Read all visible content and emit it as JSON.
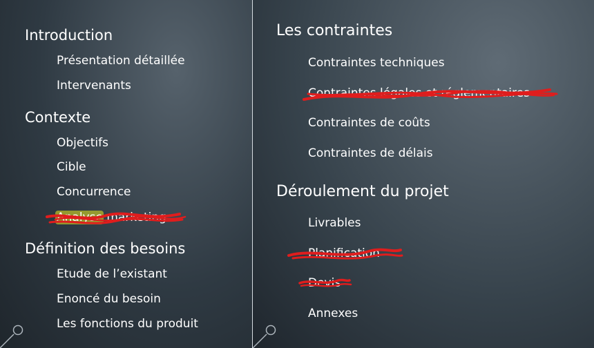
{
  "left_column": {
    "section1": {
      "title": "Introduction",
      "items": [
        "Présentation détaillée",
        "Intervenants"
      ]
    },
    "section2": {
      "title": "Contexte",
      "items": [
        "Objectifs",
        "Cible",
        "Concurrence",
        "Analyse marketing"
      ]
    },
    "section3": {
      "title": "Définition des besoins",
      "items": [
        "Etude de l’existant",
        "Enoncé du besoin",
        "Les fonctions du produit"
      ]
    }
  },
  "right_column": {
    "section1": {
      "title": "Les contraintes",
      "items": [
        "Contraintes techniques",
        "Contraintes légales et réglementaires",
        "Contraintes de coûts",
        "Contraintes de délais"
      ]
    },
    "section2": {
      "title": "Déroulement du projet",
      "items": [
        "Livrables",
        "Planification",
        "Devis",
        "Annexes"
      ]
    }
  },
  "annotations": {
    "strikethrough_color": "#e01d1d",
    "crossed_out_items": [
      "Analyse marketing",
      "Contraintes légales et réglementaires",
      "Planification",
      "Devis"
    ],
    "highlight_color": "#b7b928"
  },
  "icons": [
    "corner-ring-icon",
    "corner-ring-icon"
  ]
}
